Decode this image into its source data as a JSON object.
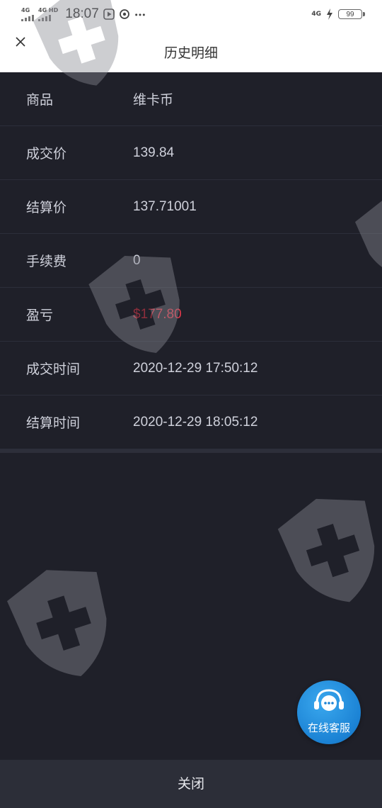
{
  "status_bar": {
    "sim1": "4G",
    "sim2": "4G HD",
    "time": "18:07",
    "network": "4G",
    "battery": "99"
  },
  "header": {
    "title": "历史明细"
  },
  "details": [
    {
      "label": "商品",
      "value": "维卡币"
    },
    {
      "label": "成交价",
      "value": "139.84"
    },
    {
      "label": "结算价",
      "value": "137.71001"
    },
    {
      "label": "手续费",
      "value": "0"
    },
    {
      "label": "盈亏",
      "value": "$177.80"
    },
    {
      "label": "成交时间",
      "value": "2020-12-29 17:50:12"
    },
    {
      "label": "结算时间",
      "value": "2020-12-29 18:05:12"
    }
  ],
  "customer_service": {
    "label": "在线客服"
  },
  "footer": {
    "close_label": "关闭"
  },
  "colors": {
    "background": "#1f2029",
    "loss": "#e0394a",
    "cs_blue": "#1b82d4"
  }
}
